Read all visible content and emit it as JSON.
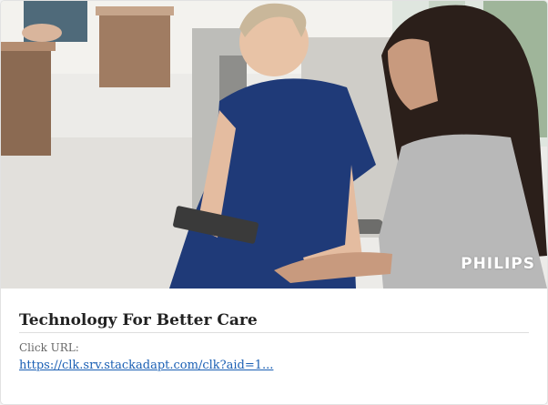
{
  "ad": {
    "brand": "PHILIPS",
    "title": "Technology For Better Care",
    "click_url_label": "Click URL:",
    "click_url": "https://clk.srv.stackadapt.com/clk?aid=1..."
  },
  "colors": {
    "link": "#1a5fb4",
    "title": "#222222",
    "scrubs": "#1f3a78",
    "cardigan": "#b8b8b8"
  }
}
